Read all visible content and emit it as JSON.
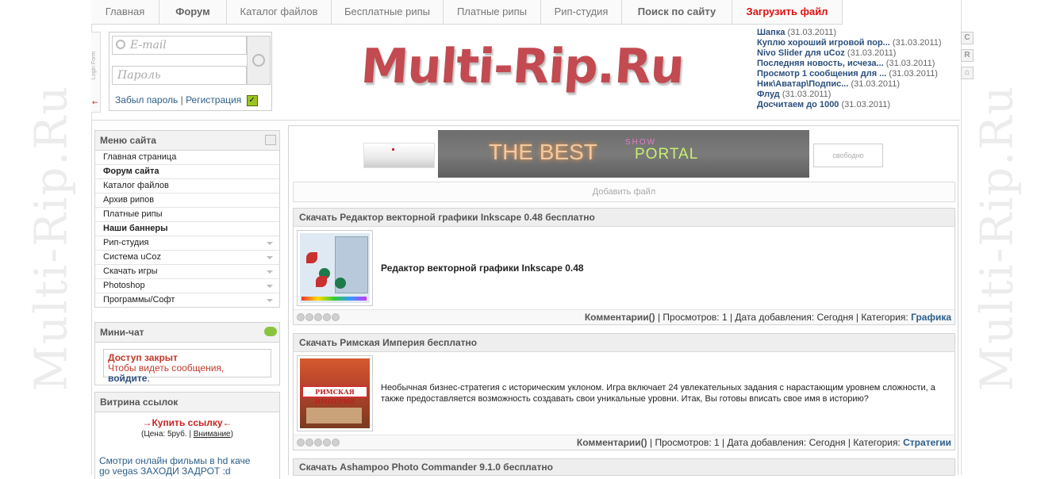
{
  "watermark": "Multi-Rip.Ru",
  "nav": [
    {
      "label": "Главная",
      "style": "normal"
    },
    {
      "label": "Форум",
      "style": "bold"
    },
    {
      "label": "Каталог файлов",
      "style": "normal"
    },
    {
      "label": "Бесплатные рипы",
      "style": "normal"
    },
    {
      "label": "Платные рипы",
      "style": "normal"
    },
    {
      "label": "Рип-студия",
      "style": "normal"
    },
    {
      "label": "Поиск по сайту",
      "style": "bold"
    },
    {
      "label": "Загрузить файл",
      "style": "red"
    }
  ],
  "login": {
    "tab_text": "Login Form",
    "email_placeholder": "E-mail",
    "password_placeholder": "Пароль",
    "forgot": "Забыл пароль",
    "separator": "|",
    "register": "Регистрация"
  },
  "logo": "Multi-Rip.Ru",
  "latest": [
    {
      "title": "Шапка",
      "date": "(31.03.2011)"
    },
    {
      "title": "Куплю хороший игровой пор...",
      "date": "(31.03.2011)"
    },
    {
      "title": "Nivo Slider для uCoz",
      "date": "(31.03.2011)"
    },
    {
      "title": "Последняя новость, исчеза...",
      "date": "(31.03.2011)"
    },
    {
      "title": "Просмотр 1 сообщения для ...",
      "date": "(31.03.2011)"
    },
    {
      "title": "Ник\\Аватар\\Подпис...",
      "date": "(31.03.2011)"
    },
    {
      "title": "Флуд",
      "date": "(31.03.2011)"
    },
    {
      "title": "Досчитаем до 1000",
      "date": "(31.03.2011)"
    }
  ],
  "side_icons": [
    "C",
    "R",
    "⌂"
  ],
  "menu": {
    "title": "Меню сайта",
    "items": [
      {
        "label": "Главная страница",
        "bold": false,
        "arrow": false
      },
      {
        "label": "Форум сайта",
        "bold": true,
        "arrow": false
      },
      {
        "label": "Каталог файлов",
        "bold": false,
        "arrow": false
      },
      {
        "label": "Архив рипов",
        "bold": false,
        "arrow": false
      },
      {
        "label": "Платные рипы",
        "bold": false,
        "arrow": false
      },
      {
        "label": "Наши баннеры",
        "bold": true,
        "arrow": false
      },
      {
        "label": "Рип-студия",
        "bold": false,
        "arrow": true
      },
      {
        "label": "Система uCoz",
        "bold": false,
        "arrow": true
      },
      {
        "label": "Скачать игры",
        "bold": false,
        "arrow": true
      },
      {
        "label": "Photoshop",
        "bold": false,
        "arrow": true
      },
      {
        "label": "Программы/Софт",
        "bold": false,
        "arrow": true
      }
    ]
  },
  "chat": {
    "title": "Мини-чат",
    "closed": "Доступ закрыт",
    "hint": "Чтобы видеть сообщения,",
    "login_link": "войдите",
    "end": "."
  },
  "links": {
    "title": "Витрина ссылок",
    "buy": "→Купить ссылку←",
    "price_prefix": "(Цена: 5руб. |",
    "price_link": "Внимание",
    "price_suffix": ")",
    "ad_line1": "Смотри онлайн фильмы в hd каче",
    "ad_line2": "go vegas ЗАХОДИ ЗАДРОТ :d"
  },
  "banners": {
    "main_text1": "THE BEST",
    "main_text2": "PORTAL",
    "main_text3": "SHOW",
    "free": "свободно"
  },
  "add_file": "Добавить файл",
  "entries": [
    {
      "title": "Скачать Редактор векторной графики Inkscape 0.48 бесплатно",
      "text": "Редактор векторной графики Inkscape 0.48",
      "comments": "Комментарии()",
      "views": "| Просмотров: 1 | Дата добавления: Сегодня | Категория:",
      "category": "Графика"
    },
    {
      "title": "Скачать Римская Империя бесплатно",
      "text": "Необычная бизнес-стратегия с историческим уклоном. Игра включает 24 увлекательных задания с нарастающим уровнем сложности, а также предоставляется возможность создавать свои уникальные уровни. Итак, Вы готовы вписать свое имя в историю?",
      "thumb_label": "РИМСКАЯ ИМПЕРИЯ",
      "comments": "Комментарии()",
      "views": "| Просмотров: 1 | Дата добавления: Сегодня | Категория:",
      "category": "Стратегии"
    }
  ],
  "entry3_title": "Скачать Ashampoo Photo Commander 9.1.0 бесплатно"
}
